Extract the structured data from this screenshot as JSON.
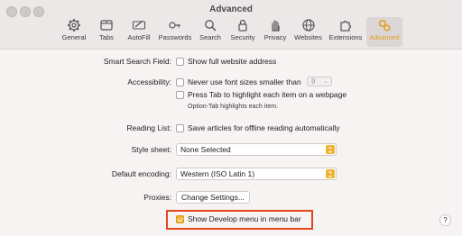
{
  "window": {
    "title": "Advanced"
  },
  "toolbar": {
    "items": [
      {
        "label": "General",
        "icon": "gear-icon"
      },
      {
        "label": "Tabs",
        "icon": "tabs-icon"
      },
      {
        "label": "AutoFill",
        "icon": "autofill-icon"
      },
      {
        "label": "Passwords",
        "icon": "key-icon"
      },
      {
        "label": "Search",
        "icon": "search-icon"
      },
      {
        "label": "Security",
        "icon": "lock-icon"
      },
      {
        "label": "Privacy",
        "icon": "hand-icon"
      },
      {
        "label": "Websites",
        "icon": "globe-icon"
      },
      {
        "label": "Extensions",
        "icon": "puzzle-icon"
      },
      {
        "label": "Advanced",
        "icon": "gears-icon",
        "active": true
      }
    ]
  },
  "settings": {
    "smart_search": {
      "label": "Smart Search Field:",
      "option": "Show full website address"
    },
    "accessibility": {
      "label": "Accessibility:",
      "min_font_option": "Never use font sizes smaller than",
      "min_font_value": "9",
      "tab_option": "Press Tab to highlight each item on a webpage",
      "tab_hint": "Option-Tab highlights each item."
    },
    "reading_list": {
      "label": "Reading List:",
      "option": "Save articles for offline reading automatically"
    },
    "style_sheet": {
      "label": "Style sheet:",
      "value": "None Selected"
    },
    "encoding": {
      "label": "Default encoding:",
      "value": "Western (ISO Latin 1)"
    },
    "proxies": {
      "label": "Proxies:",
      "button": "Change Settings..."
    },
    "develop_menu": {
      "option": "Show Develop menu in menu bar",
      "checked": true
    },
    "help": "?"
  },
  "colors": {
    "accent": "#f0b431",
    "highlight": "#e4471f"
  }
}
